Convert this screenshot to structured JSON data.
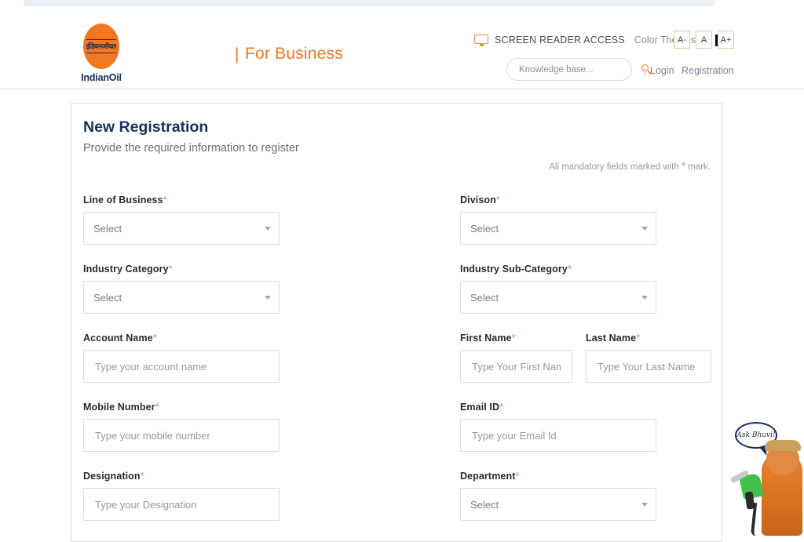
{
  "header": {
    "logo": {
      "devanagari": "इंडियनऑयल",
      "wordmark": "IndianOil",
      "name": "indianoil-logo"
    },
    "brand_divider": "|",
    "brand_title": "For Business",
    "accessibility": {
      "monitor_icon": "screen-reader-icon",
      "screen_reader_label": "SCREEN READER ACCESS",
      "color_themes_label": "Color Themes",
      "themes": [
        {
          "name": "theme-white",
          "color": "#ffffff"
        },
        {
          "name": "theme-black",
          "color": "#0b0b0b"
        }
      ],
      "font_buttons": [
        {
          "name": "font-decrease",
          "label": "A-"
        },
        {
          "name": "font-normal",
          "label": "A"
        },
        {
          "name": "font-increase",
          "label": "A+"
        }
      ]
    },
    "search": {
      "placeholder": "Knowledge base...",
      "value": "",
      "icon": "search-icon"
    },
    "auth": {
      "separator": "|",
      "login_label": "Login",
      "registration_label": "Registration"
    }
  },
  "card": {
    "title": "New Registration",
    "subtitle": "Provide the required information to register",
    "mandatory_note_before": "All mandatory fields marked with",
    "mandatory_star": "*",
    "mandatory_note_after": "mark."
  },
  "form": {
    "required_marker": "*",
    "select_placeholder": "Select",
    "rows": [
      {
        "left": {
          "name": "line-of-business",
          "label": "Line of Business",
          "required": true,
          "type": "select",
          "value": "Select"
        },
        "right": {
          "name": "divison",
          "label": "Divison",
          "required": true,
          "type": "select",
          "value": "Select"
        }
      },
      {
        "left": {
          "name": "industry-category",
          "label": "Industry Category",
          "required": true,
          "type": "select",
          "value": "Select"
        },
        "right": {
          "name": "industry-sub-category",
          "label": "Industry Sub-Category",
          "required": true,
          "type": "select",
          "value": "Select"
        }
      },
      {
        "left": {
          "name": "account-name",
          "label": "Account Name",
          "required": true,
          "type": "text",
          "value": "",
          "placeholder": "Type your account name"
        },
        "right": {
          "name": "first-name",
          "label": "First Name",
          "required": true,
          "type": "text",
          "value": "",
          "placeholder": "Type Your First Name"
        },
        "extra": {
          "name": "last-name",
          "label": "Last Name",
          "required": true,
          "type": "text",
          "value": "",
          "placeholder": "Type Your Last Name"
        }
      },
      {
        "left": {
          "name": "mobile-number",
          "label": "Mobile Number",
          "required": true,
          "type": "text",
          "value": "",
          "placeholder": "Type your mobile number"
        },
        "right": {
          "name": "email-id",
          "label": "Email ID",
          "required": true,
          "type": "text",
          "value": "",
          "placeholder": "Type your Email Id"
        }
      },
      {
        "left": {
          "name": "designation",
          "label": "Designation",
          "required": true,
          "type": "text",
          "value": "",
          "placeholder": "Type your Designation"
        },
        "right": {
          "name": "department",
          "label": "Department",
          "required": true,
          "type": "select",
          "value": "Select"
        }
      }
    ]
  },
  "mascot": {
    "name": "ask-bhuvi-chatbot",
    "bubble_text": "Ask Bhuvi!"
  },
  "colors": {
    "brand_orange": "#f47721",
    "heading_navy": "#1c2f5c",
    "required_orange": "#f0894a",
    "border_gray": "#dedede"
  }
}
